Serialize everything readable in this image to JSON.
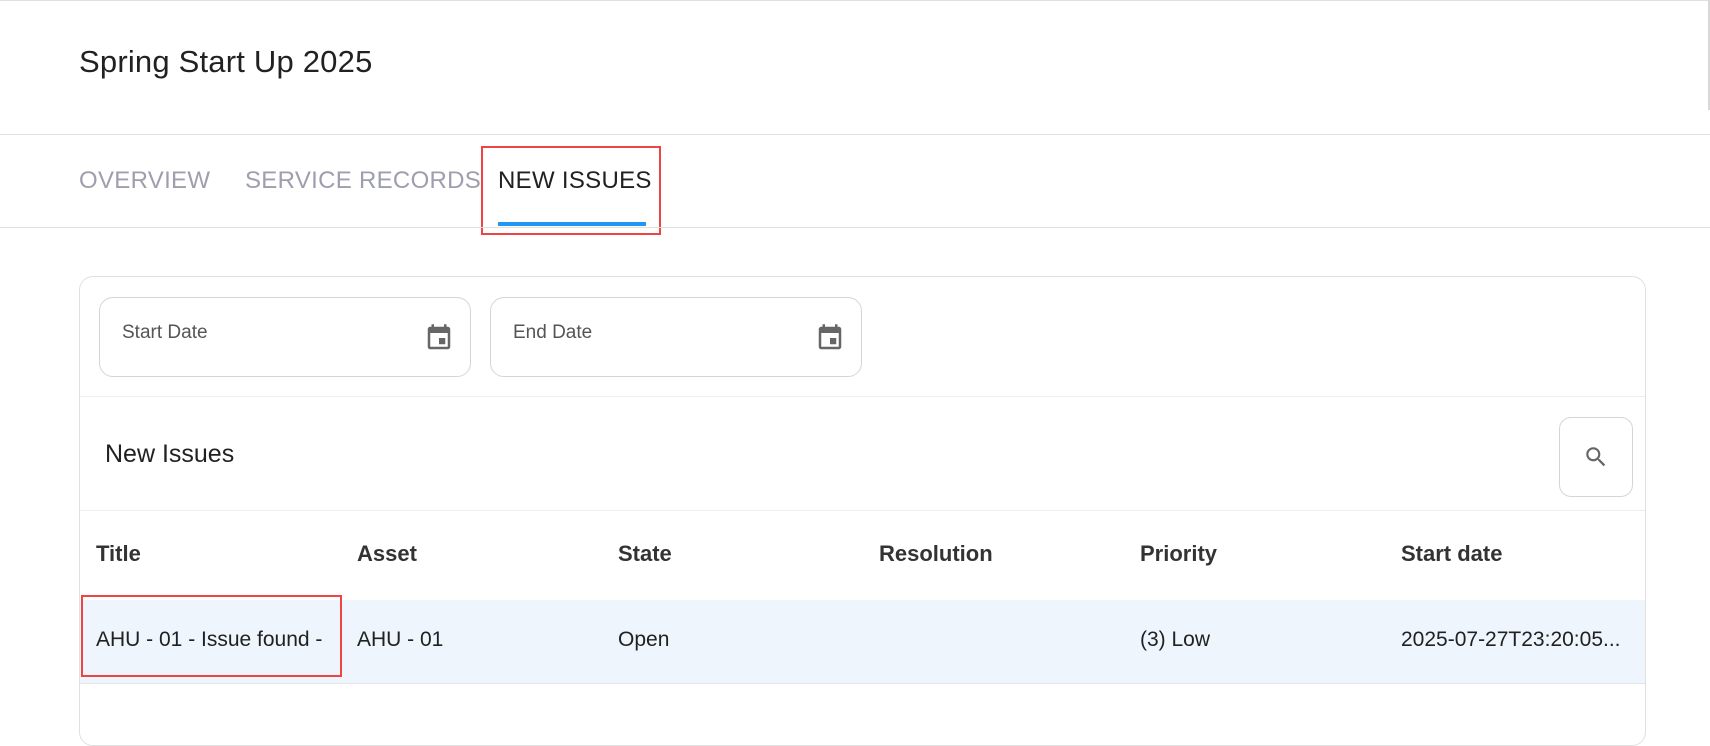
{
  "page": {
    "title": "Spring Start Up 2025"
  },
  "tabs": [
    {
      "label": "OVERVIEW",
      "active": false
    },
    {
      "label": "SERVICE RECORDS",
      "active": false
    },
    {
      "label": "NEW ISSUES",
      "active": true
    }
  ],
  "filters": {
    "start_date": {
      "label": "Start Date",
      "icon": "calendar-icon"
    },
    "end_date": {
      "label": "End Date",
      "icon": "calendar-icon"
    }
  },
  "section": {
    "title": "New Issues",
    "search_icon": "search-icon"
  },
  "table": {
    "columns": [
      "Title",
      "Asset",
      "State",
      "Resolution",
      "Priority",
      "Start date"
    ],
    "rows": [
      {
        "title": "AHU - 01 - Issue found -",
        "asset": "AHU - 01",
        "state": "Open",
        "resolution": "",
        "priority": "(3) Low",
        "start_date": "2025-07-27T23:20:05..."
      }
    ]
  },
  "colors": {
    "accent": "#2196f3",
    "highlight": "#ef4444",
    "row_selected": "#eef5fd",
    "tab_inactive": "#9e9eae"
  }
}
